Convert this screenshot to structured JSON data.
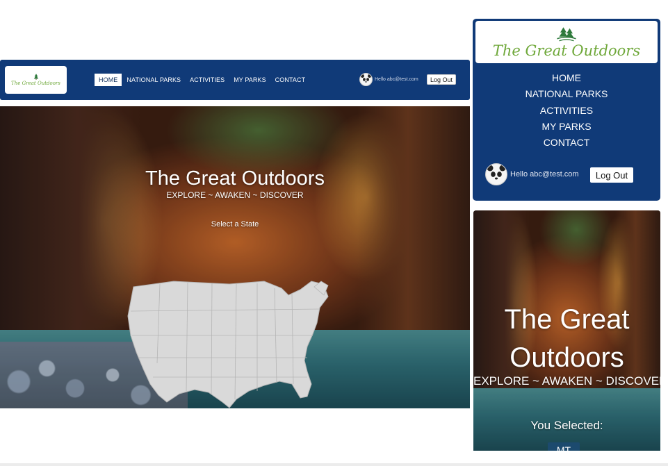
{
  "brand": {
    "name": "The Great Outdoors",
    "logo_color": "#6fa83a",
    "nav_color": "#103a78"
  },
  "desktop": {
    "nav": {
      "items": [
        {
          "label": "HOME",
          "active": true
        },
        {
          "label": "NATIONAL PARKS",
          "active": false
        },
        {
          "label": "ACTIVITIES",
          "active": false
        },
        {
          "label": "MY PARKS",
          "active": false
        },
        {
          "label": "CONTACT",
          "active": false
        }
      ],
      "greeting": "Hello abc@test.com",
      "logout_label": "Log Out"
    },
    "hero": {
      "title": "The Great Outdoors",
      "tagline": "EXPLORE ~ AWAKEN ~ DISCOVER",
      "select_prompt": "Select a State"
    }
  },
  "mobile": {
    "nav": {
      "items": [
        {
          "label": "HOME"
        },
        {
          "label": "NATIONAL PARKS"
        },
        {
          "label": "ACTIVITIES"
        },
        {
          "label": "MY PARKS"
        },
        {
          "label": "CONTACT"
        }
      ],
      "greeting": "Hello abc@test.com",
      "logout_label": "Log Out"
    },
    "hero": {
      "title": "The Great Outdoors",
      "tagline": "EXPLORE ~ AWAKEN ~ DISCOVER",
      "selected_label": "You Selected:",
      "selected_state": "MT"
    }
  },
  "icons": {
    "logo": "pine-trees-icon",
    "avatar": "panda-avatar-icon",
    "map": "us-states-map"
  }
}
